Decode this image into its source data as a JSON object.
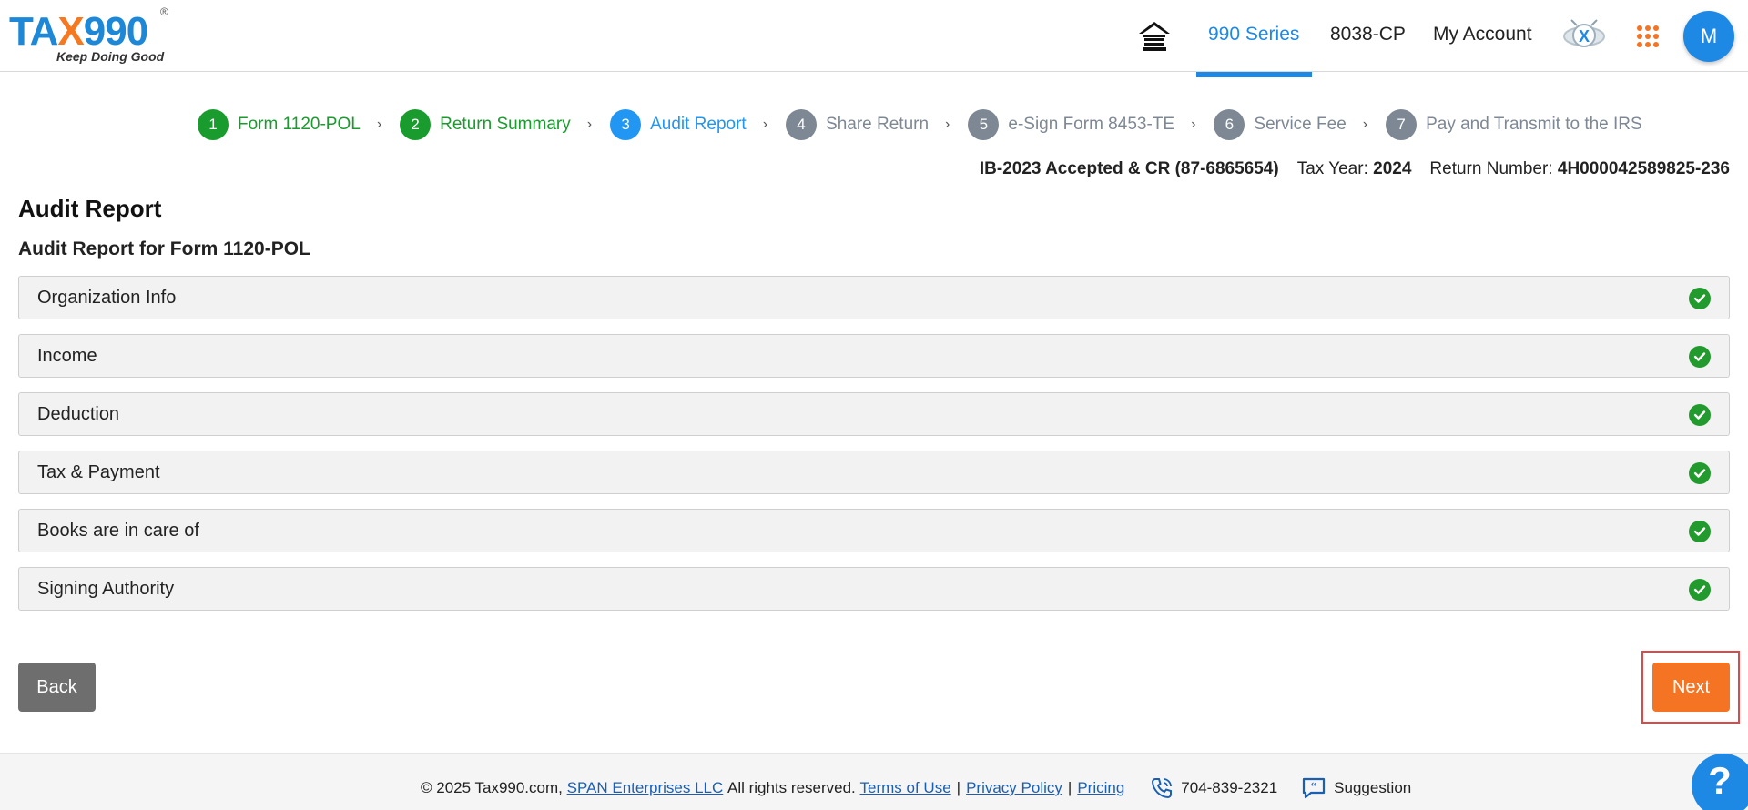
{
  "header": {
    "logo_text_a": "TA",
    "logo_text_x": "X",
    "logo_text_b": "990",
    "logo_reg": "®",
    "logo_tagline": "Keep Doing Good",
    "nav": {
      "series": "990 Series",
      "form8038": "8038-CP",
      "account": "My Account"
    },
    "avatar_initial": "M",
    "icons": {
      "home": "home-icon",
      "x": "x-logo-icon",
      "apps": "apps-grid-icon"
    }
  },
  "stepper": [
    {
      "num": "1",
      "label": "Form 1120-POL",
      "state": "done"
    },
    {
      "num": "2",
      "label": "Return Summary",
      "state": "done"
    },
    {
      "num": "3",
      "label": "Audit Report",
      "state": "active"
    },
    {
      "num": "4",
      "label": "Share Return",
      "state": "pending"
    },
    {
      "num": "5",
      "label": "e-Sign Form 8453-TE",
      "state": "pending"
    },
    {
      "num": "6",
      "label": "Service Fee",
      "state": "pending"
    },
    {
      "num": "7",
      "label": "Pay and Transmit to the IRS",
      "state": "pending"
    }
  ],
  "return_info": {
    "org": "IB-2023 Accepted & CR (87-6865654)",
    "tax_year_label": "Tax Year:",
    "tax_year": "2024",
    "return_number_label": "Return Number:",
    "return_number": "4H000042589825-236"
  },
  "page": {
    "title": "Audit Report",
    "subtitle": "Audit Report for Form 1120-POL"
  },
  "sections": [
    {
      "label": "Organization Info",
      "status": "complete"
    },
    {
      "label": "Income",
      "status": "complete"
    },
    {
      "label": "Deduction",
      "status": "complete"
    },
    {
      "label": "Tax & Payment",
      "status": "complete"
    },
    {
      "label": "Books are in care of",
      "status": "complete"
    },
    {
      "label": "Signing Authority",
      "status": "complete"
    }
  ],
  "buttons": {
    "back": "Back",
    "next": "Next"
  },
  "footer": {
    "copyright": "© 2025 Tax990.com,",
    "company": "SPAN Enterprises LLC",
    "rights": "All rights reserved.",
    "terms": "Terms of Use",
    "privacy": "Privacy Policy",
    "pricing": "Pricing",
    "separator": "|",
    "phone": "704-839-2321",
    "suggestion": "Suggestion",
    "help": "?"
  },
  "colors": {
    "primary": "#1e88e5",
    "success": "#1a9b2e",
    "pending": "#7d8894",
    "next_button": "#f47423",
    "back_button": "#6e6e6e"
  }
}
